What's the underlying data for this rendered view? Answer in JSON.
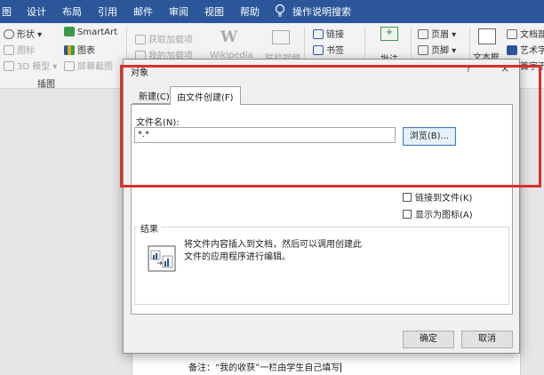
{
  "ribbon_tabs": [
    "图",
    "设计",
    "布局",
    "引用",
    "邮件",
    "审阅",
    "视图",
    "帮助"
  ],
  "tell_me": "操作说明搜索",
  "ribbon": {
    "shapes": "形状",
    "icons": "图标",
    "model3d": "3D 模型",
    "smartart": "SmartArt",
    "chart": "图表",
    "screenshot": "屏幕截图",
    "group_illustrations": "插图",
    "get_addins": "获取加载项",
    "my_addins": "我的加载项",
    "wikipedia": "Wikipedia",
    "online_video": "联机视频",
    "link": "链接",
    "bookmark": "书签",
    "comment": "批注",
    "header": "页眉",
    "footer": "页脚",
    "textbox": "文本框",
    "doc_parts": "文档部件",
    "wordart": "艺术字",
    "dropcap": "首字下沉"
  },
  "dialog": {
    "title": "对象",
    "help": "?",
    "close": "×",
    "tab_new": "新建(C)",
    "tab_from_file": "由文件创建(F)",
    "file_name_label": "文件名(N):",
    "file_name_value": "*.*",
    "browse_button": "浏览(B)...",
    "link_to_file": "链接到文件(K)",
    "display_as_icon": "显示为图标(A)",
    "result_label": "结果",
    "result_text": "将文件内容插入到文档，然后可以调用创建此文件的应用程序进行编辑。",
    "ok_button": "确定",
    "cancel_button": "取消"
  },
  "document": {
    "note_line": "备注：“我的收获”一栏由学生自己填写"
  },
  "colors": {
    "ribbon_blue": "#2b579a",
    "highlight_red": "#d9302c"
  }
}
